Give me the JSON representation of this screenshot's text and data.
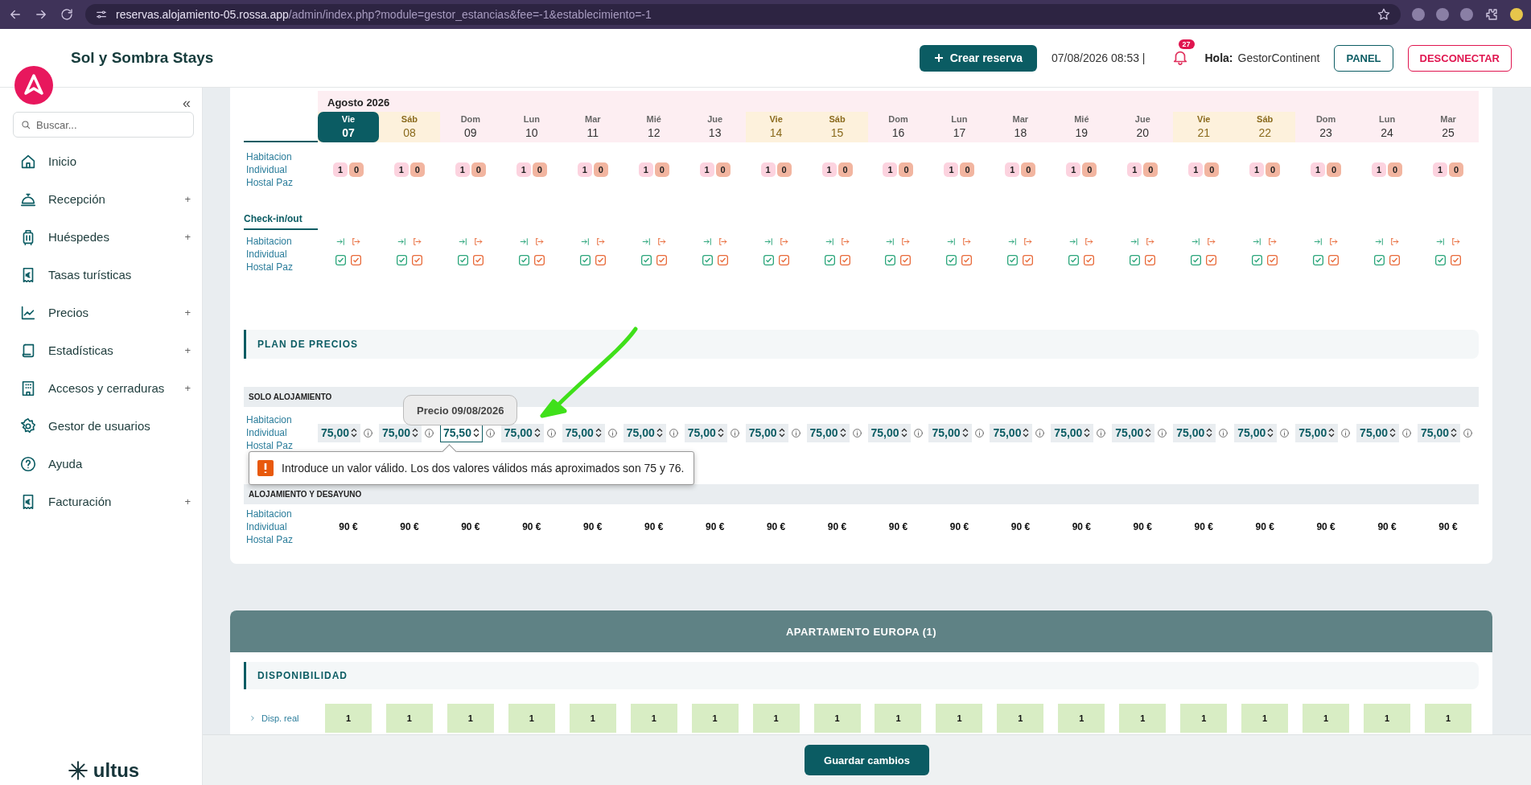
{
  "browser": {
    "url_host": "reservas.alojamiento-05.rossa.app",
    "url_path": "/admin/index.php?module=gestor_estancias&fee=-1&establecimiento=-1"
  },
  "header": {
    "title": "Sol y Sombra Stays",
    "create_button": "Crear reserva",
    "datetime": "07/08/2026 08:53 |",
    "notifications": "27",
    "greeting": "Hola:",
    "user": "GestorContinent",
    "panel_button": "PANEL",
    "logout_button": "DESCONECTAR"
  },
  "sidebar": {
    "search": {
      "placeholder": "Buscar..."
    },
    "collapse": "«",
    "items": [
      {
        "label": "Inicio"
      },
      {
        "label": "Recepción",
        "expander": "+"
      },
      {
        "label": "Huéspedes",
        "expander": "+"
      },
      {
        "label": "Tasas turísticas"
      },
      {
        "label": "Precios",
        "expander": "+"
      },
      {
        "label": "Estadísticas",
        "expander": "+"
      },
      {
        "label": "Accesos y cerraduras",
        "expander": "+"
      },
      {
        "label": "Gestor de usuarios"
      },
      {
        "label": "Ayuda"
      },
      {
        "label": "Facturación",
        "expander": "+"
      }
    ],
    "brand": "ultus"
  },
  "calendar": {
    "month": "Agosto 2026",
    "days": [
      {
        "weekday": "Vie",
        "day": "07",
        "weekend": true,
        "selected": true
      },
      {
        "weekday": "Sáb",
        "day": "08",
        "weekend": true,
        "selected": false
      },
      {
        "weekday": "Dom",
        "day": "09",
        "weekend": false,
        "selected": false
      },
      {
        "weekday": "Lun",
        "day": "10",
        "weekend": false,
        "selected": false
      },
      {
        "weekday": "Mar",
        "day": "11",
        "weekend": false,
        "selected": false
      },
      {
        "weekday": "Mié",
        "day": "12",
        "weekend": false,
        "selected": false
      },
      {
        "weekday": "Jue",
        "day": "13",
        "weekend": false,
        "selected": false
      },
      {
        "weekday": "Vie",
        "day": "14",
        "weekend": true,
        "selected": false
      },
      {
        "weekday": "Sáb",
        "day": "15",
        "weekend": true,
        "selected": false
      },
      {
        "weekday": "Dom",
        "day": "16",
        "weekend": false,
        "selected": false
      },
      {
        "weekday": "Lun",
        "day": "17",
        "weekend": false,
        "selected": false
      },
      {
        "weekday": "Mar",
        "day": "18",
        "weekend": false,
        "selected": false
      },
      {
        "weekday": "Mié",
        "day": "19",
        "weekend": false,
        "selected": false
      },
      {
        "weekday": "Jue",
        "day": "20",
        "weekend": false,
        "selected": false
      },
      {
        "weekday": "Vie",
        "day": "21",
        "weekend": true,
        "selected": false
      },
      {
        "weekday": "Sáb",
        "day": "22",
        "weekend": true,
        "selected": false
      },
      {
        "weekday": "Dom",
        "day": "23",
        "weekend": false,
        "selected": false
      },
      {
        "weekday": "Lun",
        "day": "24",
        "weekend": false,
        "selected": false
      },
      {
        "weekday": "Mar",
        "day": "25",
        "weekend": false,
        "selected": false
      }
    ]
  },
  "availability": {
    "room": "Habitacion Individual Hostal Paz",
    "values": [
      [
        "1",
        "0"
      ],
      [
        "1",
        "0"
      ],
      [
        "1",
        "0"
      ],
      [
        "1",
        "0"
      ],
      [
        "1",
        "0"
      ],
      [
        "1",
        "0"
      ],
      [
        "1",
        "0"
      ],
      [
        "1",
        "0"
      ],
      [
        "1",
        "0"
      ],
      [
        "1",
        "0"
      ],
      [
        "1",
        "0"
      ],
      [
        "1",
        "0"
      ],
      [
        "1",
        "0"
      ],
      [
        "1",
        "0"
      ],
      [
        "1",
        "0"
      ],
      [
        "1",
        "0"
      ],
      [
        "1",
        "0"
      ],
      [
        "1",
        "0"
      ],
      [
        "1",
        "0"
      ]
    ]
  },
  "checkin": {
    "title": "Check-in/out",
    "room": "Habitacion Individual Hostal Paz",
    "columns": [
      {
        "in_checked": true,
        "out_checked": true
      },
      {
        "in_checked": true,
        "out_checked": true
      },
      {
        "in_checked": true,
        "out_checked": true
      },
      {
        "in_checked": true,
        "out_checked": true
      },
      {
        "in_checked": true,
        "out_checked": true
      },
      {
        "in_checked": true,
        "out_checked": true
      },
      {
        "in_checked": true,
        "out_checked": true
      },
      {
        "in_checked": true,
        "out_checked": true
      },
      {
        "in_checked": true,
        "out_checked": true
      },
      {
        "in_checked": true,
        "out_checked": true
      },
      {
        "in_checked": true,
        "out_checked": true
      },
      {
        "in_checked": true,
        "out_checked": true
      },
      {
        "in_checked": true,
        "out_checked": true
      },
      {
        "in_checked": true,
        "out_checked": true
      },
      {
        "in_checked": true,
        "out_checked": true
      },
      {
        "in_checked": true,
        "out_checked": true
      },
      {
        "in_checked": true,
        "out_checked": true
      },
      {
        "in_checked": true,
        "out_checked": true
      },
      {
        "in_checked": true,
        "out_checked": true
      }
    ]
  },
  "pricing": {
    "title": "PLAN DE PRECIOS",
    "plans": [
      {
        "name": "SOLO ALOJAMIENTO",
        "room": "Habitacion Individual Hostal Paz",
        "kind": "input",
        "prices": [
          {
            "value": "75,00",
            "focused": false
          },
          {
            "value": "75,00",
            "focused": false
          },
          {
            "value": "75,50",
            "focused": true
          },
          {
            "value": "75,00",
            "focused": false
          },
          {
            "value": "75,00",
            "focused": false
          },
          {
            "value": "75,00",
            "focused": false
          },
          {
            "value": "75,00",
            "focused": false
          },
          {
            "value": "75,00",
            "focused": false
          },
          {
            "value": "75,00",
            "focused": false
          },
          {
            "value": "75,00",
            "focused": false
          },
          {
            "value": "75,00",
            "focused": false
          },
          {
            "value": "75,00",
            "focused": false
          },
          {
            "value": "75,00",
            "focused": false
          },
          {
            "value": "75,00",
            "focused": false
          },
          {
            "value": "75,00",
            "focused": false
          },
          {
            "value": "75,00",
            "focused": false
          },
          {
            "value": "75,00",
            "focused": false
          },
          {
            "value": "75,00",
            "focused": false
          },
          {
            "value": "75,00",
            "focused": false
          }
        ]
      },
      {
        "name": "ALOJAMIENTO Y DESAYUNO",
        "room": "Habitacion Individual Hostal Paz",
        "kind": "text",
        "prices": [
          {
            "value": "90 €"
          },
          {
            "value": "90 €"
          },
          {
            "value": "90 €"
          },
          {
            "value": "90 €"
          },
          {
            "value": "90 €"
          },
          {
            "value": "90 €"
          },
          {
            "value": "90 €"
          },
          {
            "value": "90 €"
          },
          {
            "value": "90 €"
          },
          {
            "value": "90 €"
          },
          {
            "value": "90 €"
          },
          {
            "value": "90 €"
          },
          {
            "value": "90 €"
          },
          {
            "value": "90 €"
          },
          {
            "value": "90 €"
          },
          {
            "value": "90 €"
          },
          {
            "value": "90 €"
          },
          {
            "value": "90 €"
          },
          {
            "value": "90 €"
          }
        ]
      }
    ],
    "tooltip": "Precio 09/08/2026",
    "validation_message": "Introduce un valor válido. Los dos valores válidos más aproximados son 75 y 76."
  },
  "apartment": {
    "title": "APARTAMENTO EUROPA (1)",
    "section": "DISPONIBILIDAD",
    "row_label": "Disp. real",
    "values": [
      "1",
      "1",
      "1",
      "1",
      "1",
      "1",
      "1",
      "1",
      "1",
      "1",
      "1",
      "1",
      "1",
      "1",
      "1",
      "1",
      "1",
      "1",
      "1"
    ]
  },
  "save_button": "Guardar cambios"
}
